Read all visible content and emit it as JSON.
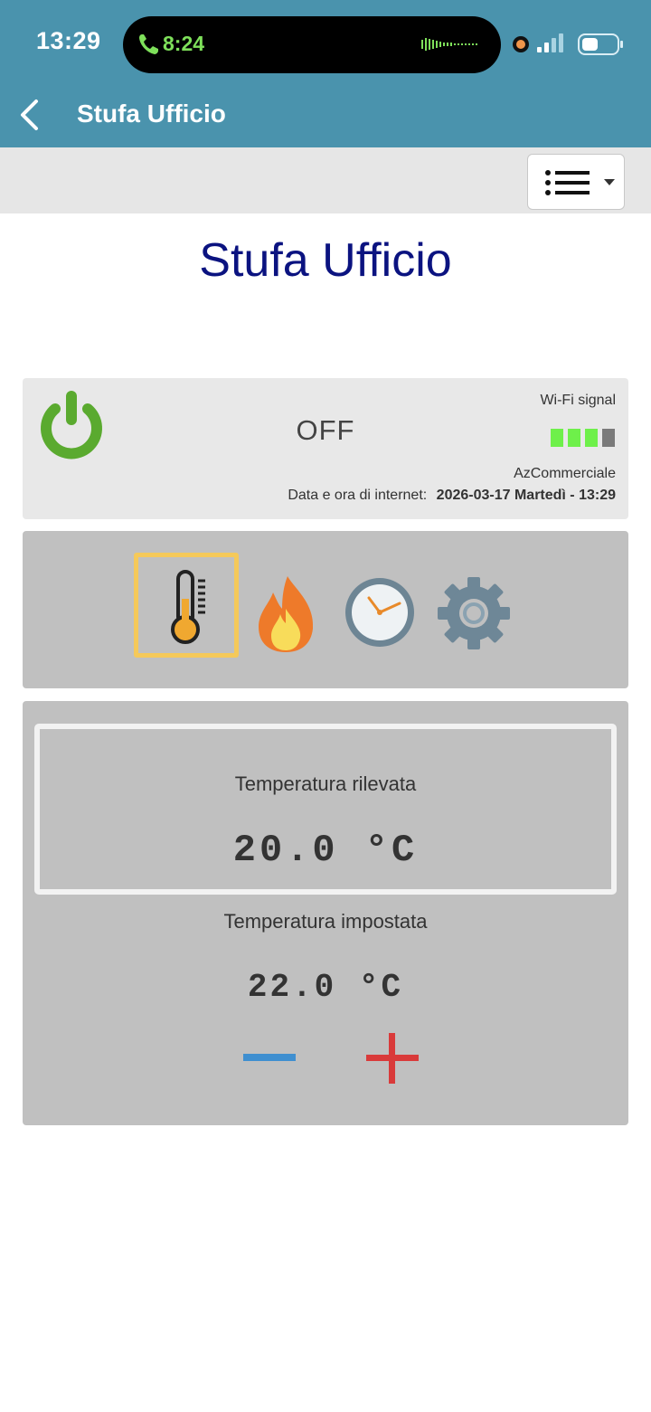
{
  "status_bar": {
    "time": "13:29",
    "call_time": "8:24"
  },
  "nav": {
    "title": "Stufa Ufficio"
  },
  "page": {
    "title": "Stufa Ufficio"
  },
  "device_status": {
    "state": "OFF",
    "wifi_label": "Wi-Fi signal",
    "wifi_strength_bars": 3,
    "wifi_total_bars": 4,
    "network_name": "AzCommerciale",
    "datetime_label": "Data e ora di internet:",
    "datetime_value": "2026-03-17 Martedì - 13:29"
  },
  "tabs": [
    {
      "name": "temperature",
      "icon": "thermometer-icon",
      "selected": true
    },
    {
      "name": "power",
      "icon": "flame-icon",
      "selected": false
    },
    {
      "name": "schedule",
      "icon": "clock-icon",
      "selected": false
    },
    {
      "name": "settings",
      "icon": "gear-icon",
      "selected": false
    }
  ],
  "temperature": {
    "measured_label": "Temperatura rilevata",
    "measured_value": "20.0 °C",
    "set_label": "Temperatura impostata",
    "set_value": "22.0 °C"
  },
  "colors": {
    "header": "#4a93ad",
    "title": "#0b1380",
    "power_on_icon": "#5aaa2f",
    "wifi_active": "#6ef04a",
    "wifi_inactive": "#7a7a7a",
    "selected_tab_border": "#f5c95a",
    "minus": "#3f8fd0",
    "plus": "#d93a3a"
  }
}
